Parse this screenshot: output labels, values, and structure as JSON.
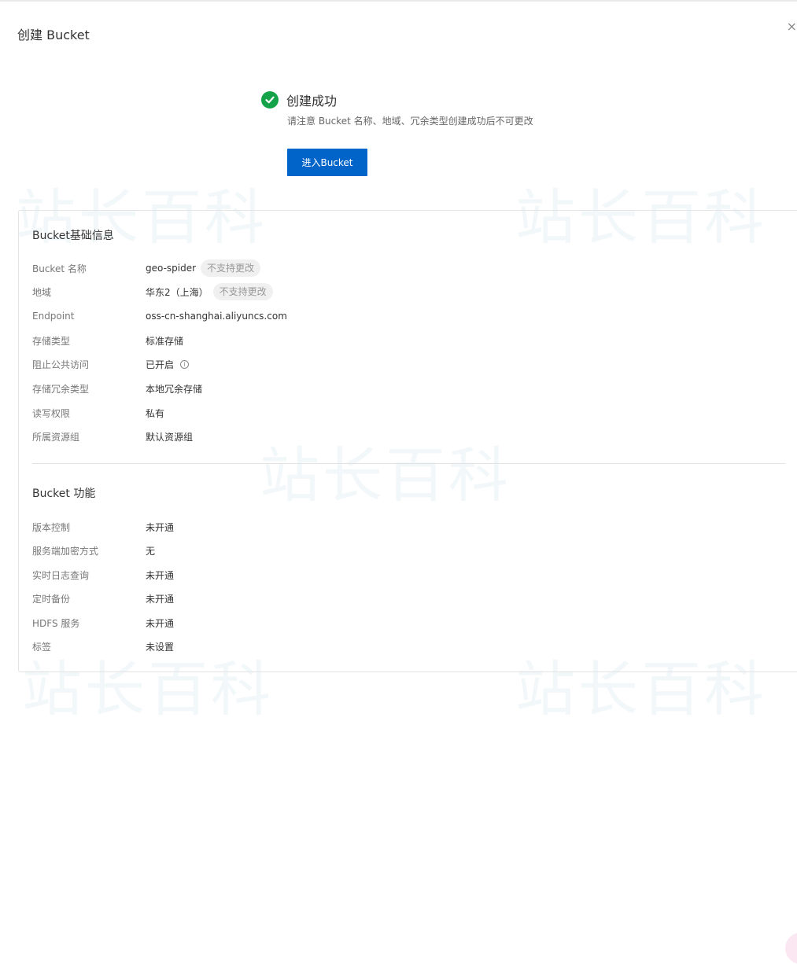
{
  "dialog": {
    "title": "创建 Bucket",
    "close_icon": "×"
  },
  "watermark": {
    "text": "站长百科"
  },
  "success": {
    "title": "创建成功",
    "description": "请注意 Bucket 名称、地域、冗余类型创建成功后不可更改",
    "button_label": "进入Bucket",
    "icon": "check-circle-icon",
    "color": "#15a34a"
  },
  "basic_info": {
    "title": "Bucket基础信息",
    "rows": [
      {
        "label": "Bucket 名称",
        "value": "geo-spider",
        "tag": "不支持更改"
      },
      {
        "label": "地域",
        "value": "华东2（上海）",
        "tag": "不支持更改"
      },
      {
        "label": "Endpoint",
        "value": "oss-cn-shanghai.aliyuncs.com"
      },
      {
        "label": "存储类型",
        "value": "标准存储"
      },
      {
        "label": "阻止公共访问",
        "value": "已开启",
        "info_icon": "i"
      },
      {
        "label": "存储冗余类型",
        "value": "本地冗余存储"
      },
      {
        "label": "读写权限",
        "value": "私有"
      },
      {
        "label": "所属资源组",
        "value": "默认资源组"
      }
    ]
  },
  "features": {
    "title": "Bucket 功能",
    "rows": [
      {
        "label": "版本控制",
        "value": "未开通"
      },
      {
        "label": "服务端加密方式",
        "value": "无"
      },
      {
        "label": "实时日志查询",
        "value": "未开通"
      },
      {
        "label": "定时备份",
        "value": "未开通"
      },
      {
        "label": "HDFS 服务",
        "value": "未开通"
      },
      {
        "label": "标签",
        "value": "未设置"
      }
    ]
  },
  "colors": {
    "primary": "#0064c8",
    "success": "#15a34a"
  }
}
